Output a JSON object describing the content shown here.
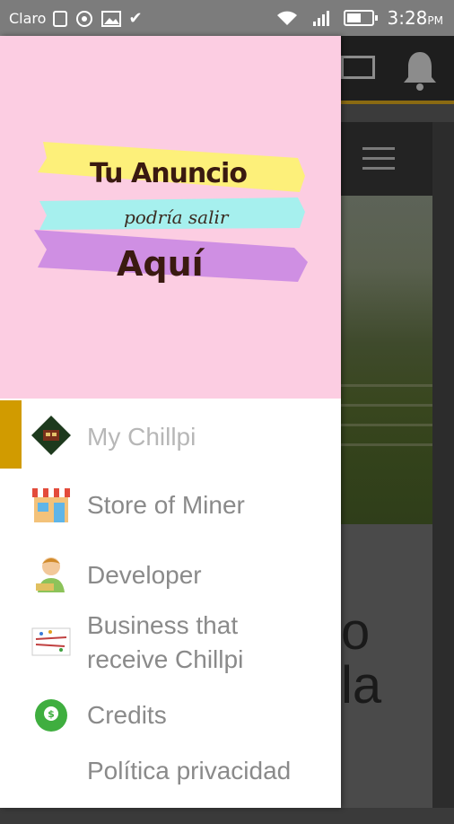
{
  "status_bar": {
    "carrier": "Claro",
    "time": "3:28",
    "ampm": "PM"
  },
  "banner": {
    "line1": "Tu Anuncio",
    "line2": "podría salir",
    "line3": "Aquí",
    "colors": {
      "background": "#fccde2",
      "yellow": "#fdf07a",
      "cyan": "#a6f0ee",
      "purple": "#cf8fe3"
    }
  },
  "drawer": {
    "items": [
      {
        "label": "My Chillpi",
        "icon": "chillpi-logo-icon",
        "active": true
      },
      {
        "label": "Store of Miner",
        "icon": "store-icon",
        "active": false
      },
      {
        "label": "Developer",
        "icon": "developer-icon",
        "active": false
      },
      {
        "label": "Business that receive Chillpi",
        "icon": "business-icon",
        "active": false
      },
      {
        "label": "Credits",
        "icon": "credits-icon",
        "active": false
      },
      {
        "label": "Política privacidad",
        "icon": "",
        "active": false
      }
    ],
    "accent_color": "#d19b00"
  },
  "background": {
    "big_text_lines": [
      "o",
      "la"
    ]
  }
}
